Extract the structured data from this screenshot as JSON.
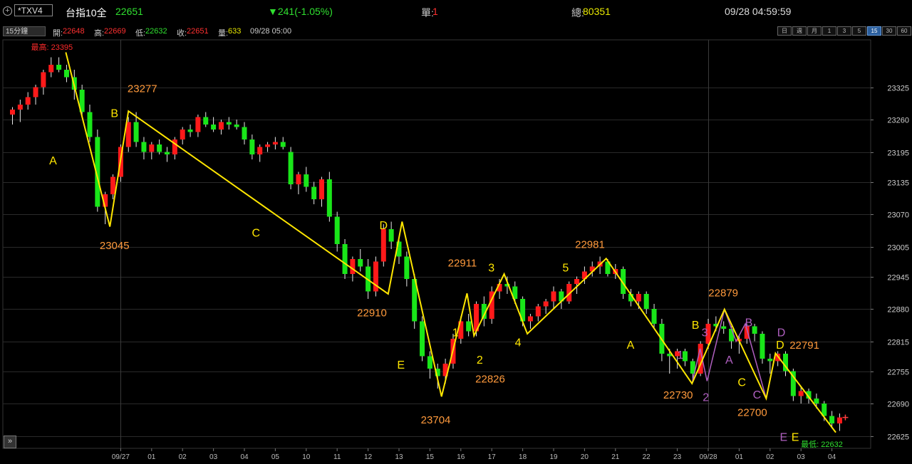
{
  "topbar": {
    "symbol": "*TXV4",
    "name": "台指10全",
    "price": "22651",
    "change": "▼241(-1.05%)",
    "single_label": "單:",
    "single_value": "1",
    "total_label": "總:",
    "total_value": "80351",
    "datetime": "09/28 04:59:59"
  },
  "infobar": {
    "interval": "15分鐘",
    "open_label": "開:",
    "open": "22648",
    "high_label": "高:",
    "high": "22669",
    "low_label": "低:",
    "low": "22632",
    "close_label": "收:",
    "close": "22651",
    "volume_label": "量:",
    "volume": "633",
    "time": "09/28 05:00",
    "periods": [
      "日",
      "週",
      "月",
      "1",
      "3",
      "5",
      "15",
      "30",
      "60"
    ],
    "active_period": "15"
  },
  "colors": {
    "up": "#ff1a1a",
    "down": "#19e619",
    "wave": "#ffe600",
    "purple": "#b060c0",
    "label": "#ff9a3c",
    "grid": "#2a2a2a"
  },
  "chart_data": {
    "type": "candlestick",
    "ylim": [
      22600,
      23420
    ],
    "y_ticks": [
      23325,
      23260,
      23195,
      23135,
      23070,
      23005,
      22945,
      22880,
      22815,
      22755,
      22690,
      22625
    ],
    "x_ticks": [
      {
        "i": 14,
        "label": "09/27"
      },
      {
        "i": 18,
        "label": "01"
      },
      {
        "i": 22,
        "label": "02"
      },
      {
        "i": 26,
        "label": "03"
      },
      {
        "i": 30,
        "label": "04"
      },
      {
        "i": 34,
        "label": "05"
      },
      {
        "i": 38,
        "label": "10"
      },
      {
        "i": 42,
        "label": "11"
      },
      {
        "i": 46,
        "label": "12"
      },
      {
        "i": 50,
        "label": "13"
      },
      {
        "i": 54,
        "label": "15"
      },
      {
        "i": 58,
        "label": "16"
      },
      {
        "i": 62,
        "label": "17"
      },
      {
        "i": 66,
        "label": "18"
      },
      {
        "i": 70,
        "label": "19"
      },
      {
        "i": 74,
        "label": "20"
      },
      {
        "i": 78,
        "label": "21"
      },
      {
        "i": 82,
        "label": "22"
      },
      {
        "i": 86,
        "label": "23"
      },
      {
        "i": 90,
        "label": "09/28"
      },
      {
        "i": 94,
        "label": "01"
      },
      {
        "i": 98,
        "label": "02"
      },
      {
        "i": 102,
        "label": "03"
      },
      {
        "i": 106,
        "label": "04"
      }
    ],
    "candles": [
      [
        23270,
        23285,
        23250,
        23280
      ],
      [
        23280,
        23300,
        23255,
        23290
      ],
      [
        23290,
        23315,
        23280,
        23305
      ],
      [
        23305,
        23330,
        23290,
        23325
      ],
      [
        23325,
        23360,
        23310,
        23355
      ],
      [
        23355,
        23385,
        23345,
        23370
      ],
      [
        23370,
        23385,
        23355,
        23360
      ],
      [
        23360,
        23370,
        23335,
        23345
      ],
      [
        23345,
        23360,
        23300,
        23320
      ],
      [
        23320,
        23330,
        23265,
        23275
      ],
      [
        23275,
        23290,
        23215,
        23225
      ],
      [
        23225,
        23240,
        23075,
        23085
      ],
      [
        23085,
        23115,
        23050,
        23110
      ],
      [
        23110,
        23150,
        23100,
        23145
      ],
      [
        23145,
        23210,
        23135,
        23205
      ],
      [
        23205,
        23265,
        23195,
        23255
      ],
      [
        23255,
        23275,
        23205,
        23215
      ],
      [
        23215,
        23225,
        23180,
        23195
      ],
      [
        23195,
        23215,
        23180,
        23210
      ],
      [
        23210,
        23220,
        23190,
        23195
      ],
      [
        23195,
        23205,
        23175,
        23190
      ],
      [
        23190,
        23225,
        23180,
        23220
      ],
      [
        23220,
        23245,
        23210,
        23240
      ],
      [
        23240,
        23250,
        23225,
        23235
      ],
      [
        23235,
        23270,
        23225,
        23265
      ],
      [
        23265,
        23275,
        23245,
        23250
      ],
      [
        23250,
        23265,
        23235,
        23240
      ],
      [
        23240,
        23260,
        23230,
        23255
      ],
      [
        23255,
        23265,
        23240,
        23250
      ],
      [
        23250,
        23260,
        23240,
        23245
      ],
      [
        23245,
        23255,
        23210,
        23220
      ],
      [
        23220,
        23230,
        23180,
        23190
      ],
      [
        23190,
        23210,
        23175,
        23205
      ],
      [
        23205,
        23215,
        23195,
        23210
      ],
      [
        23210,
        23225,
        23200,
        23215
      ],
      [
        23215,
        23225,
        23200,
        23205
      ],
      [
        23195,
        23205,
        23120,
        23130
      ],
      [
        23130,
        23155,
        23110,
        23150
      ],
      [
        23150,
        23165,
        23115,
        23125
      ],
      [
        23125,
        23135,
        23090,
        23100
      ],
      [
        23100,
        23145,
        23085,
        23140
      ],
      [
        23140,
        23155,
        23055,
        23065
      ],
      [
        23065,
        23075,
        22995,
        23010
      ],
      [
        23010,
        23020,
        22940,
        22950
      ],
      [
        22950,
        22985,
        22935,
        22980
      ],
      [
        22980,
        23000,
        22955,
        22965
      ],
      [
        22965,
        22980,
        22900,
        22915
      ],
      [
        22915,
        22985,
        22905,
        22975
      ],
      [
        22975,
        23050,
        22965,
        23040
      ],
      [
        23040,
        23055,
        23000,
        23015
      ],
      [
        23015,
        23025,
        22970,
        22985
      ],
      [
        22985,
        22995,
        22925,
        22940
      ],
      [
        22940,
        22950,
        22840,
        22855
      ],
      [
        22855,
        22865,
        22775,
        22785
      ],
      [
        22785,
        22795,
        22740,
        22760
      ],
      [
        22760,
        22770,
        22720,
        22745
      ],
      [
        22745,
        22780,
        22730,
        22770
      ],
      [
        22770,
        22830,
        22760,
        22820
      ],
      [
        22820,
        22865,
        22810,
        22855
      ],
      [
        22855,
        22870,
        22825,
        22835
      ],
      [
        22835,
        22895,
        22825,
        22890
      ],
      [
        22890,
        22905,
        22845,
        22860
      ],
      [
        22860,
        22925,
        22850,
        22915
      ],
      [
        22915,
        22940,
        22900,
        22930
      ],
      [
        22930,
        22945,
        22910,
        22925
      ],
      [
        22925,
        22935,
        22890,
        22900
      ],
      [
        22900,
        22905,
        22845,
        22855
      ],
      [
        22855,
        22870,
        22840,
        22865
      ],
      [
        22865,
        22890,
        22855,
        22885
      ],
      [
        22885,
        22900,
        22870,
        22895
      ],
      [
        22895,
        22925,
        22880,
        22915
      ],
      [
        22915,
        22920,
        22880,
        22895
      ],
      [
        22895,
        22935,
        22890,
        22930
      ],
      [
        22930,
        22945,
        22910,
        22940
      ],
      [
        22940,
        22965,
        22930,
        22955
      ],
      [
        22955,
        22975,
        22945,
        22965
      ],
      [
        22965,
        22985,
        22950,
        22975
      ],
      [
        22975,
        22980,
        22945,
        22950
      ],
      [
        22950,
        22970,
        22940,
        22960
      ],
      [
        22960,
        22965,
        22900,
        22910
      ],
      [
        22910,
        22920,
        22885,
        22895
      ],
      [
        22895,
        22915,
        22880,
        22910
      ],
      [
        22910,
        22915,
        22870,
        22880
      ],
      [
        22880,
        22890,
        22840,
        22850
      ],
      [
        22850,
        22860,
        22775,
        22790
      ],
      [
        22790,
        22800,
        22750,
        22785
      ],
      [
        22785,
        22800,
        22760,
        22795
      ],
      [
        22795,
        22800,
        22765,
        22775
      ],
      [
        22775,
        22780,
        22735,
        22750
      ],
      [
        22750,
        22815,
        22745,
        22810
      ],
      [
        22810,
        22860,
        22800,
        22850
      ],
      [
        22850,
        22865,
        22835,
        22845
      ],
      [
        22845,
        22855,
        22830,
        22840
      ],
      [
        22840,
        22845,
        22800,
        22815
      ],
      [
        22815,
        22825,
        22790,
        22820
      ],
      [
        22820,
        22850,
        22810,
        22845
      ],
      [
        22845,
        22850,
        22815,
        22830
      ],
      [
        22830,
        22835,
        22770,
        22780
      ],
      [
        22780,
        22790,
        22750,
        22775
      ],
      [
        22775,
        22795,
        22765,
        22790
      ],
      [
        22790,
        22795,
        22745,
        22755
      ],
      [
        22755,
        22760,
        22695,
        22705
      ],
      [
        22705,
        22725,
        22690,
        22715
      ],
      [
        22715,
        22720,
        22690,
        22700
      ],
      [
        22700,
        22710,
        22680,
        22690
      ],
      [
        22690,
        22695,
        22655,
        22665
      ],
      [
        22665,
        22675,
        22640,
        22650
      ],
      [
        22650,
        22670,
        22635,
        22662
      ]
    ],
    "wave": [
      {
        "i": 4.6,
        "p": 23395
      },
      {
        "i": 8.4,
        "p": 23045
      },
      {
        "i": 10.0,
        "p": 23277
      },
      {
        "i": 32.4,
        "p": 22910
      },
      {
        "i": 33.6,
        "p": 23055
      },
      {
        "i": 37.0,
        "p": 22704
      },
      {
        "i": 39.2,
        "p": 22911
      },
      {
        "i": 39.8,
        "p": 22826
      },
      {
        "i": 42.4,
        "p": 22950
      },
      {
        "i": 44.4,
        "p": 22830
      },
      {
        "i": 51.2,
        "p": 22981
      },
      {
        "i": 58.6,
        "p": 22730
      },
      {
        "i": 61.4,
        "p": 22879
      },
      {
        "i": 65.0,
        "p": 22700
      },
      {
        "i": 65.8,
        "p": 22791
      },
      {
        "i": 71.0,
        "p": 22632
      }
    ],
    "purple_wave": [
      {
        "i": 58.6,
        "p": 22730
      },
      {
        "i": 59.3,
        "p": 22800
      },
      {
        "i": 59.9,
        "p": 22735
      },
      {
        "i": 61.4,
        "p": 22879
      },
      {
        "i": 62.4,
        "p": 22815
      },
      {
        "i": 63.2,
        "p": 22850
      },
      {
        "i": 65.0,
        "p": 22700
      },
      {
        "i": 65.8,
        "p": 22791
      },
      {
        "i": 71.0,
        "p": 22632
      }
    ],
    "annotations": [
      {
        "text": "最高: 23395",
        "i": 3.4,
        "p": 23400,
        "color": "red",
        "size": 11
      },
      {
        "text": "A",
        "i": 3.5,
        "p": 23170,
        "color": "wave",
        "size": 16
      },
      {
        "text": "B",
        "i": 8.8,
        "p": 23265,
        "color": "wave",
        "size": 16
      },
      {
        "text": "23277",
        "i": 11.2,
        "p": 23315,
        "color": "label",
        "size": 15
      },
      {
        "text": "23045",
        "i": 8.8,
        "p": 23000,
        "color": "label",
        "size": 15
      },
      {
        "text": "C",
        "i": 21.0,
        "p": 23025,
        "color": "wave",
        "size": 16
      },
      {
        "text": "D",
        "i": 32.0,
        "p": 23040,
        "color": "wave",
        "size": 16
      },
      {
        "text": "22910",
        "i": 31.0,
        "p": 22865,
        "color": "label",
        "size": 15
      },
      {
        "text": "E",
        "i": 33.5,
        "p": 22760,
        "color": "wave",
        "size": 16
      },
      {
        "text": "23704",
        "i": 36.5,
        "p": 22650,
        "color": "label",
        "size": 15
      },
      {
        "text": "1",
        "i": 38.2,
        "p": 22825,
        "color": "wave",
        "size": 16
      },
      {
        "text": "22911",
        "i": 38.8,
        "p": 22965,
        "color": "label",
        "size": 15
      },
      {
        "text": "2",
        "i": 40.3,
        "p": 22770,
        "color": "wave",
        "size": 16
      },
      {
        "text": "22826",
        "i": 41.2,
        "p": 22732,
        "color": "label",
        "size": 15
      },
      {
        "text": "3",
        "i": 41.3,
        "p": 22955,
        "color": "wave",
        "size": 16
      },
      {
        "text": "4",
        "i": 43.6,
        "p": 22805,
        "color": "wave",
        "size": 16
      },
      {
        "text": "5",
        "i": 47.7,
        "p": 22955,
        "color": "wave",
        "size": 16
      },
      {
        "text": "22981",
        "i": 49.8,
        "p": 23002,
        "color": "label",
        "size": 15
      },
      {
        "text": "A",
        "i": 53.3,
        "p": 22800,
        "color": "wave",
        "size": 16
      },
      {
        "text": "B",
        "i": 58.9,
        "p": 22840,
        "color": "wave",
        "size": 16
      },
      {
        "text": "1",
        "i": 57.6,
        "p": 22780,
        "color": "purple",
        "size": 16
      },
      {
        "text": "22730",
        "i": 57.4,
        "p": 22700,
        "color": "label",
        "size": 15
      },
      {
        "text": "2",
        "i": 59.8,
        "p": 22695,
        "color": "purple",
        "size": 16
      },
      {
        "text": "3",
        "i": 59.7,
        "p": 22825,
        "color": "purple",
        "size": 16
      },
      {
        "text": "22879",
        "i": 61.3,
        "p": 22905,
        "color": "label",
        "size": 15
      },
      {
        "text": "A",
        "i": 61.8,
        "p": 22770,
        "color": "purple",
        "size": 16
      },
      {
        "text": "B",
        "i": 63.5,
        "p": 22845,
        "color": "purple",
        "size": 16
      },
      {
        "text": "C",
        "i": 62.9,
        "p": 22725,
        "color": "wave",
        "size": 16
      },
      {
        "text": "22700",
        "i": 63.8,
        "p": 22665,
        "color": "label",
        "size": 15
      },
      {
        "text": "C",
        "i": 64.2,
        "p": 22700,
        "color": "purple",
        "size": 16
      },
      {
        "text": "D",
        "i": 66.3,
        "p": 22825,
        "color": "purple",
        "size": 16
      },
      {
        "text": "D",
        "i": 66.2,
        "p": 22800,
        "color": "wave",
        "size": 16
      },
      {
        "text": "22791",
        "i": 68.3,
        "p": 22800,
        "color": "label",
        "size": 15
      },
      {
        "text": "E",
        "i": 66.5,
        "p": 22615,
        "color": "purple",
        "size": 16
      },
      {
        "text": "E",
        "i": 67.5,
        "p": 22615,
        "color": "wave",
        "size": 16
      },
      {
        "text": "最低: 22632",
        "i": 69.8,
        "p": 22603,
        "color": "down",
        "size": 11
      }
    ]
  }
}
